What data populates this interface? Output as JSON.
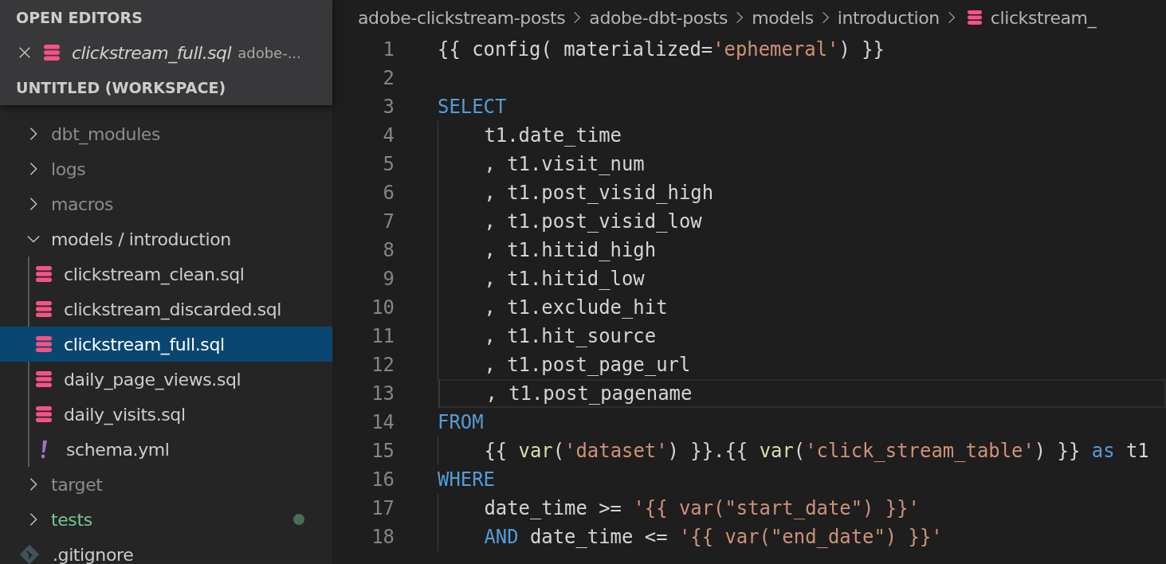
{
  "sidebar": {
    "open_editors": {
      "title": "OPEN EDITORS",
      "items": [
        {
          "name": "clickstream_full.sql",
          "description": "adobe-...",
          "kind": "sql",
          "preview": true
        }
      ]
    },
    "workspace": {
      "title": "UNTITLED (WORKSPACE)"
    },
    "tree": [
      {
        "label": "dbt_modules",
        "kind": "folder",
        "expanded": false,
        "ignored": true,
        "untracked": false
      },
      {
        "label": "logs",
        "kind": "folder",
        "expanded": false,
        "ignored": true,
        "untracked": false
      },
      {
        "label": "macros",
        "kind": "folder",
        "expanded": false,
        "ignored": true,
        "untracked": false
      },
      {
        "label": "models / introduction",
        "kind": "folder",
        "expanded": true,
        "ignored": false,
        "untracked": false,
        "children": [
          {
            "label": "clickstream_clean.sql",
            "kind": "sql",
            "selected": false
          },
          {
            "label": "clickstream_discarded.sql",
            "kind": "sql",
            "selected": false
          },
          {
            "label": "clickstream_full.sql",
            "kind": "sql",
            "selected": true
          },
          {
            "label": "daily_page_views.sql",
            "kind": "sql",
            "selected": false
          },
          {
            "label": "daily_visits.sql",
            "kind": "sql",
            "selected": false
          },
          {
            "label": "schema.yml",
            "kind": "yaml",
            "selected": false
          }
        ]
      },
      {
        "label": "target",
        "kind": "folder",
        "expanded": false,
        "ignored": true,
        "untracked": false
      },
      {
        "label": "tests",
        "kind": "folder",
        "expanded": false,
        "ignored": false,
        "untracked": true
      },
      {
        "label": ".gitignore",
        "kind": "git",
        "ignored": false,
        "untracked": false
      }
    ]
  },
  "editor": {
    "breadcrumbs": [
      {
        "label": "adobe-clickstream-posts",
        "kind": "folder"
      },
      {
        "label": "adobe-dbt-posts",
        "kind": "folder"
      },
      {
        "label": "models",
        "kind": "folder"
      },
      {
        "label": "introduction",
        "kind": "folder"
      },
      {
        "label": "clickstream_",
        "kind": "sql"
      }
    ],
    "lines": [
      {
        "number": "1",
        "current": false,
        "indented": false,
        "tokens": [
          {
            "text": "{{ config( materialized=",
            "kind": "plain"
          },
          {
            "text": "'ephemeral'",
            "kind": "string"
          },
          {
            "text": ") }}",
            "kind": "plain"
          }
        ]
      },
      {
        "number": "2",
        "current": false,
        "indented": false
      },
      {
        "number": "3",
        "current": false,
        "indented": false,
        "tokens": [
          {
            "text": "SELECT",
            "kind": "keyword"
          }
        ]
      },
      {
        "number": "4",
        "current": false,
        "indented": true,
        "tokens": [
          {
            "text": "t1.date_time",
            "kind": "plain"
          }
        ]
      },
      {
        "number": "5",
        "current": false,
        "indented": true,
        "tokens": [
          {
            "text": ", t1.visit_num",
            "kind": "plain"
          }
        ]
      },
      {
        "number": "6",
        "current": false,
        "indented": true,
        "tokens": [
          {
            "text": ", t1.post_visid_high",
            "kind": "plain"
          }
        ]
      },
      {
        "number": "7",
        "current": false,
        "indented": true,
        "tokens": [
          {
            "text": ", t1.post_visid_low",
            "kind": "plain"
          }
        ]
      },
      {
        "number": "8",
        "current": false,
        "indented": true,
        "tokens": [
          {
            "text": ", t1.hitid_high",
            "kind": "plain"
          }
        ]
      },
      {
        "number": "9",
        "current": false,
        "indented": true,
        "tokens": [
          {
            "text": ", t1.hitid_low",
            "kind": "plain"
          }
        ]
      },
      {
        "number": "10",
        "current": false,
        "indented": true,
        "tokens": [
          {
            "text": ", t1.exclude_hit",
            "kind": "plain"
          }
        ]
      },
      {
        "number": "11",
        "current": false,
        "indented": true,
        "tokens": [
          {
            "text": ", t1.hit_source",
            "kind": "plain"
          }
        ]
      },
      {
        "number": "12",
        "current": false,
        "indented": true,
        "tokens": [
          {
            "text": ", t1.post_page_url",
            "kind": "plain"
          }
        ]
      },
      {
        "number": "13",
        "current": true,
        "indented": true,
        "tokens": [
          {
            "text": ", t1.post_pagename",
            "kind": "plain"
          }
        ]
      },
      {
        "number": "14",
        "current": false,
        "indented": false,
        "tokens": [
          {
            "text": "FROM",
            "kind": "keyword"
          }
        ]
      },
      {
        "number": "15",
        "current": false,
        "indented": true,
        "tokens": [
          {
            "text": "{{ ",
            "kind": "plain"
          },
          {
            "text": "var",
            "kind": "function"
          },
          {
            "text": "(",
            "kind": "plain"
          },
          {
            "text": "'dataset'",
            "kind": "string"
          },
          {
            "text": ") }}.{{ ",
            "kind": "plain"
          },
          {
            "text": "var",
            "kind": "function"
          },
          {
            "text": "(",
            "kind": "plain"
          },
          {
            "text": "'click_stream_table'",
            "kind": "string"
          },
          {
            "text": ") }} ",
            "kind": "plain"
          },
          {
            "text": "as",
            "kind": "keyword"
          },
          {
            "text": " t1",
            "kind": "plain"
          }
        ]
      },
      {
        "number": "16",
        "current": false,
        "indented": false,
        "tokens": [
          {
            "text": "WHERE",
            "kind": "keyword"
          }
        ]
      },
      {
        "number": "17",
        "current": false,
        "indented": true,
        "tokens": [
          {
            "text": "date_time >= ",
            "kind": "plain"
          },
          {
            "text": "'{{ var(\"start_date\") }}'",
            "kind": "string"
          }
        ]
      },
      {
        "number": "18",
        "current": false,
        "indented": true,
        "tokens": [
          {
            "text": "AND",
            "kind": "keyword"
          },
          {
            "text": " date_time <= ",
            "kind": "plain"
          },
          {
            "text": "'{{ var(\"end_date\") }}'",
            "kind": "string"
          }
        ]
      }
    ]
  }
}
